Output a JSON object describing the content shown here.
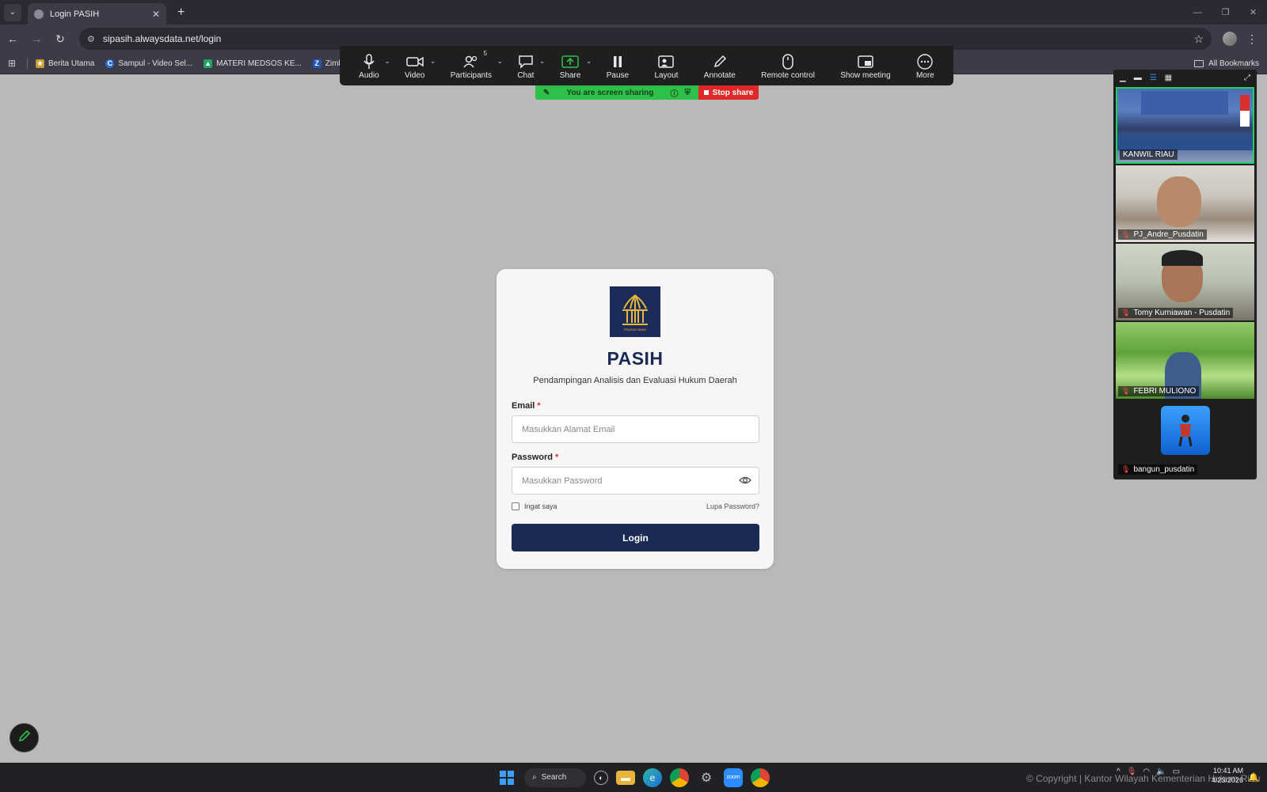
{
  "browser": {
    "tab_title": "Login PASIH",
    "url": "sipasih.alwaysdata.net/login",
    "bookmarks": [
      "Berita Utama",
      "Sampul - Video Sel...",
      "MATERI MEDSOS KE...",
      "Zimbra W"
    ],
    "all_bookmarks": "All Bookmarks"
  },
  "zoom": {
    "toolbar": {
      "audio": "Audio",
      "video": "Video",
      "participants": "Participants",
      "participants_count": "5",
      "chat": "Chat",
      "share": "Share",
      "pause": "Pause",
      "layout": "Layout",
      "annotate": "Annotate",
      "remote_control": "Remote control",
      "show_meeting": "Show meeting",
      "more": "More"
    },
    "sharing_status": "You are screen sharing",
    "stop_share": "Stop share",
    "participants": [
      {
        "name": "KANWIL RIAU"
      },
      {
        "name": "PJ_Andre_Pusdatin"
      },
      {
        "name": "Tomy Kurniawan - Pusdatin"
      },
      {
        "name": "FEBRI MULIONO"
      },
      {
        "name": "bangun_pusdatin"
      }
    ]
  },
  "login": {
    "title": "PASIH",
    "subtitle": "Pendampingan Analisis dan Evaluasi Hukum Daerah",
    "email_label": "Email",
    "email_placeholder": "Masukkan Alamat Email",
    "password_label": "Password",
    "password_placeholder": "Masukkan Password",
    "required_mark": "*",
    "remember_label": "Ingat saya",
    "forgot_label": "Lupa Password?",
    "login_button": "Login",
    "logo_text": "PENGAYOMAN"
  },
  "taskbar": {
    "search_label": "Search",
    "copyright": "© Copyright | Kantor Wilayah Kementerian Hukum Riau",
    "time": "10:41 AM",
    "date": "4/23/2026"
  },
  "colors": {
    "primary": "#1b2a55",
    "share_green": "#2ec14a",
    "stop_red": "#e02828"
  }
}
